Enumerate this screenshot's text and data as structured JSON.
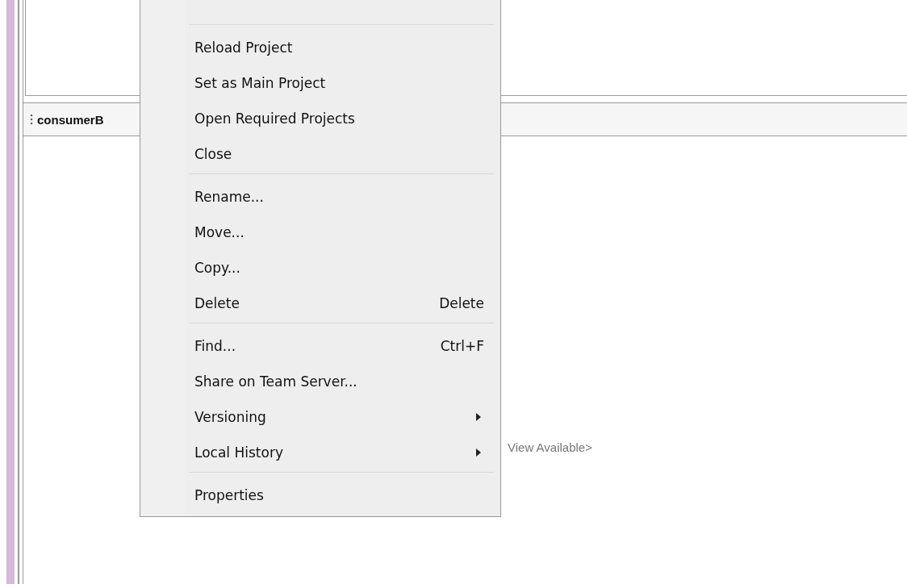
{
  "panel": {
    "title": "consumerB",
    "empty_text": "View Available>"
  },
  "context_menu": {
    "items": [
      {
        "kind": "blank"
      },
      {
        "kind": "separator"
      },
      {
        "kind": "item",
        "label": "Reload Project",
        "submenu": false
      },
      {
        "kind": "item",
        "label": "Set as Main Project",
        "submenu": false
      },
      {
        "kind": "item",
        "label": "Open Required Projects",
        "submenu": false
      },
      {
        "kind": "item",
        "label": "Close",
        "submenu": false
      },
      {
        "kind": "separator"
      },
      {
        "kind": "item",
        "label": "Rename...",
        "submenu": false
      },
      {
        "kind": "item",
        "label": "Move...",
        "submenu": false
      },
      {
        "kind": "item",
        "label": "Copy...",
        "submenu": false
      },
      {
        "kind": "item",
        "label": "Delete",
        "shortcut": "Delete",
        "submenu": false
      },
      {
        "kind": "separator"
      },
      {
        "kind": "item",
        "label": "Find...",
        "shortcut": "Ctrl+F",
        "submenu": false
      },
      {
        "kind": "item",
        "label": "Share on Team Server...",
        "submenu": false
      },
      {
        "kind": "item",
        "label": "Versioning",
        "submenu": true
      },
      {
        "kind": "item",
        "label": "Local History",
        "submenu": true
      },
      {
        "kind": "separator"
      },
      {
        "kind": "item",
        "label": "Properties",
        "submenu": false
      }
    ]
  }
}
